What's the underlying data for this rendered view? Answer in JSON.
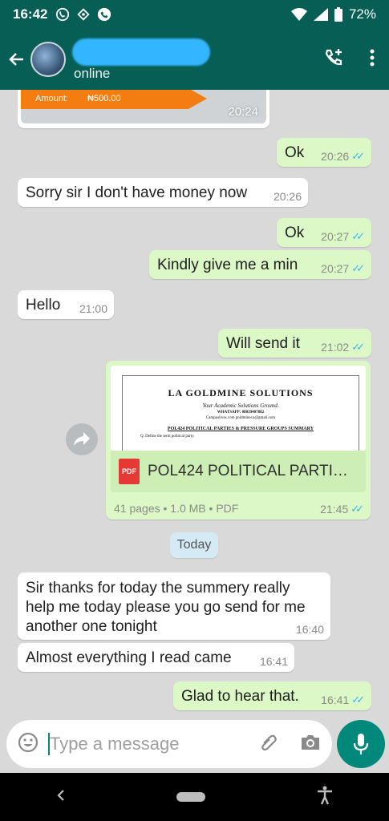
{
  "status_bar": {
    "time": "16:42",
    "battery": "72%"
  },
  "header": {
    "status": "online"
  },
  "payment_card": {
    "label": "Amount:",
    "value": "₦500.00",
    "time": "20:24"
  },
  "messages": [
    {
      "text": "Ok",
      "time": "20:26"
    },
    {
      "text": "Sorry sir I don't have money now",
      "time": "20:26"
    },
    {
      "text": "Ok",
      "time": "20:27"
    },
    {
      "text": "Kindly give me a min",
      "time": "20:27"
    },
    {
      "text": "Hello",
      "time": "21:00"
    },
    {
      "text": "Will send it",
      "time": "21:02"
    },
    {
      "lines": [
        "Sir thanks for today the summery really",
        "help me today please you go send for me",
        "another one tonight"
      ],
      "time": "16:40"
    },
    {
      "text": "Almost everything I read came",
      "time": "16:41"
    },
    {
      "text": "Glad to hear that.",
      "time": "16:41"
    }
  ],
  "document": {
    "header": "LA GOLDMINE SOLUTIONS",
    "tagline": "Your Academic Solutions Ground.",
    "whatsapp": "WHATSAPP: 08039407882",
    "site": "Campuslives.com  goldmineco@gmail.com",
    "heading": "POL424 POLITICAL PARTIES & PRESSURE GROUPS SUMMARY",
    "first_line": "Q. Define the term political party.",
    "icon_label": "PDF",
    "name": "POL424 POLITICAL PARTIE…",
    "info": "41 pages • 1.0 MB • PDF",
    "time": "21:45"
  },
  "date_divider": "Today",
  "composer": {
    "placeholder": "Type a message"
  },
  "colors": {
    "header": "#075e54",
    "outgoing": "#dcf8c6",
    "ticks": "#34b7f1",
    "accent": "#00897b"
  }
}
